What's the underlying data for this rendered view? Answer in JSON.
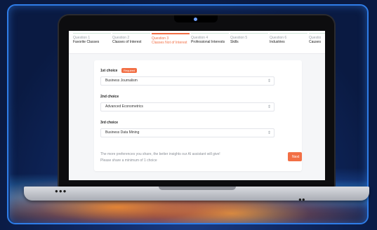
{
  "questions": [
    {
      "number": "Question 1",
      "label": "Favorite Classes",
      "active": false
    },
    {
      "number": "Question 2",
      "label": "Classes of Interest",
      "active": false
    },
    {
      "number": "Question 3",
      "label": "Classes Not of Interest",
      "active": true
    },
    {
      "number": "Question 4",
      "label": "Professional Interests",
      "active": false
    },
    {
      "number": "Question 5",
      "label": "Skills",
      "active": false
    },
    {
      "number": "Question 6",
      "label": "Industries",
      "active": false
    },
    {
      "number": "Questio",
      "label": "Causes",
      "active": false
    }
  ],
  "choices": [
    {
      "label": "1st choice",
      "value": "Business Journalism",
      "required_badge": "Required"
    },
    {
      "label": "2nd choice",
      "value": "Advanced Econometrics"
    },
    {
      "label": "3rd choice",
      "value": "Business Data Mining"
    }
  ],
  "footer": {
    "note_line1": "The more preferences you share, the better insights our AI assistant will give!",
    "note_line2": "Please share a minimum of 1 choice",
    "next_label": "Next"
  },
  "colors": {
    "accent": "#f26f45",
    "background": "#0c1e48",
    "glow": "#2f7de8"
  }
}
